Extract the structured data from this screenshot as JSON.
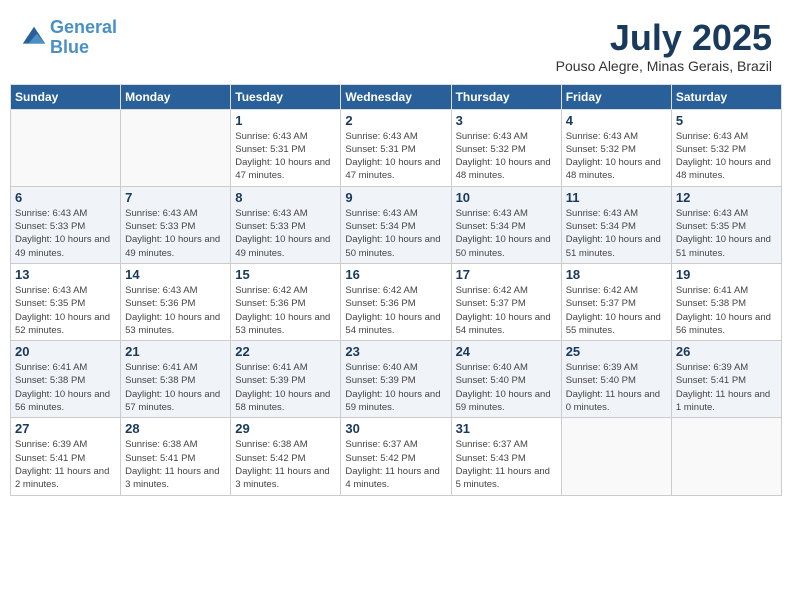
{
  "header": {
    "logo_line1": "General",
    "logo_line2": "Blue",
    "month_year": "July 2025",
    "location": "Pouso Alegre, Minas Gerais, Brazil"
  },
  "days_of_week": [
    "Sunday",
    "Monday",
    "Tuesday",
    "Wednesday",
    "Thursday",
    "Friday",
    "Saturday"
  ],
  "weeks": [
    [
      {
        "day": "",
        "info": ""
      },
      {
        "day": "",
        "info": ""
      },
      {
        "day": "1",
        "info": "Sunrise: 6:43 AM\nSunset: 5:31 PM\nDaylight: 10 hours and 47 minutes."
      },
      {
        "day": "2",
        "info": "Sunrise: 6:43 AM\nSunset: 5:31 PM\nDaylight: 10 hours and 47 minutes."
      },
      {
        "day": "3",
        "info": "Sunrise: 6:43 AM\nSunset: 5:32 PM\nDaylight: 10 hours and 48 minutes."
      },
      {
        "day": "4",
        "info": "Sunrise: 6:43 AM\nSunset: 5:32 PM\nDaylight: 10 hours and 48 minutes."
      },
      {
        "day": "5",
        "info": "Sunrise: 6:43 AM\nSunset: 5:32 PM\nDaylight: 10 hours and 48 minutes."
      }
    ],
    [
      {
        "day": "6",
        "info": "Sunrise: 6:43 AM\nSunset: 5:33 PM\nDaylight: 10 hours and 49 minutes."
      },
      {
        "day": "7",
        "info": "Sunrise: 6:43 AM\nSunset: 5:33 PM\nDaylight: 10 hours and 49 minutes."
      },
      {
        "day": "8",
        "info": "Sunrise: 6:43 AM\nSunset: 5:33 PM\nDaylight: 10 hours and 49 minutes."
      },
      {
        "day": "9",
        "info": "Sunrise: 6:43 AM\nSunset: 5:34 PM\nDaylight: 10 hours and 50 minutes."
      },
      {
        "day": "10",
        "info": "Sunrise: 6:43 AM\nSunset: 5:34 PM\nDaylight: 10 hours and 50 minutes."
      },
      {
        "day": "11",
        "info": "Sunrise: 6:43 AM\nSunset: 5:34 PM\nDaylight: 10 hours and 51 minutes."
      },
      {
        "day": "12",
        "info": "Sunrise: 6:43 AM\nSunset: 5:35 PM\nDaylight: 10 hours and 51 minutes."
      }
    ],
    [
      {
        "day": "13",
        "info": "Sunrise: 6:43 AM\nSunset: 5:35 PM\nDaylight: 10 hours and 52 minutes."
      },
      {
        "day": "14",
        "info": "Sunrise: 6:43 AM\nSunset: 5:36 PM\nDaylight: 10 hours and 53 minutes."
      },
      {
        "day": "15",
        "info": "Sunrise: 6:42 AM\nSunset: 5:36 PM\nDaylight: 10 hours and 53 minutes."
      },
      {
        "day": "16",
        "info": "Sunrise: 6:42 AM\nSunset: 5:36 PM\nDaylight: 10 hours and 54 minutes."
      },
      {
        "day": "17",
        "info": "Sunrise: 6:42 AM\nSunset: 5:37 PM\nDaylight: 10 hours and 54 minutes."
      },
      {
        "day": "18",
        "info": "Sunrise: 6:42 AM\nSunset: 5:37 PM\nDaylight: 10 hours and 55 minutes."
      },
      {
        "day": "19",
        "info": "Sunrise: 6:41 AM\nSunset: 5:38 PM\nDaylight: 10 hours and 56 minutes."
      }
    ],
    [
      {
        "day": "20",
        "info": "Sunrise: 6:41 AM\nSunset: 5:38 PM\nDaylight: 10 hours and 56 minutes."
      },
      {
        "day": "21",
        "info": "Sunrise: 6:41 AM\nSunset: 5:38 PM\nDaylight: 10 hours and 57 minutes."
      },
      {
        "day": "22",
        "info": "Sunrise: 6:41 AM\nSunset: 5:39 PM\nDaylight: 10 hours and 58 minutes."
      },
      {
        "day": "23",
        "info": "Sunrise: 6:40 AM\nSunset: 5:39 PM\nDaylight: 10 hours and 59 minutes."
      },
      {
        "day": "24",
        "info": "Sunrise: 6:40 AM\nSunset: 5:40 PM\nDaylight: 10 hours and 59 minutes."
      },
      {
        "day": "25",
        "info": "Sunrise: 6:39 AM\nSunset: 5:40 PM\nDaylight: 11 hours and 0 minutes."
      },
      {
        "day": "26",
        "info": "Sunrise: 6:39 AM\nSunset: 5:41 PM\nDaylight: 11 hours and 1 minute."
      }
    ],
    [
      {
        "day": "27",
        "info": "Sunrise: 6:39 AM\nSunset: 5:41 PM\nDaylight: 11 hours and 2 minutes."
      },
      {
        "day": "28",
        "info": "Sunrise: 6:38 AM\nSunset: 5:41 PM\nDaylight: 11 hours and 3 minutes."
      },
      {
        "day": "29",
        "info": "Sunrise: 6:38 AM\nSunset: 5:42 PM\nDaylight: 11 hours and 3 minutes."
      },
      {
        "day": "30",
        "info": "Sunrise: 6:37 AM\nSunset: 5:42 PM\nDaylight: 11 hours and 4 minutes."
      },
      {
        "day": "31",
        "info": "Sunrise: 6:37 AM\nSunset: 5:43 PM\nDaylight: 11 hours and 5 minutes."
      },
      {
        "day": "",
        "info": ""
      },
      {
        "day": "",
        "info": ""
      }
    ]
  ]
}
